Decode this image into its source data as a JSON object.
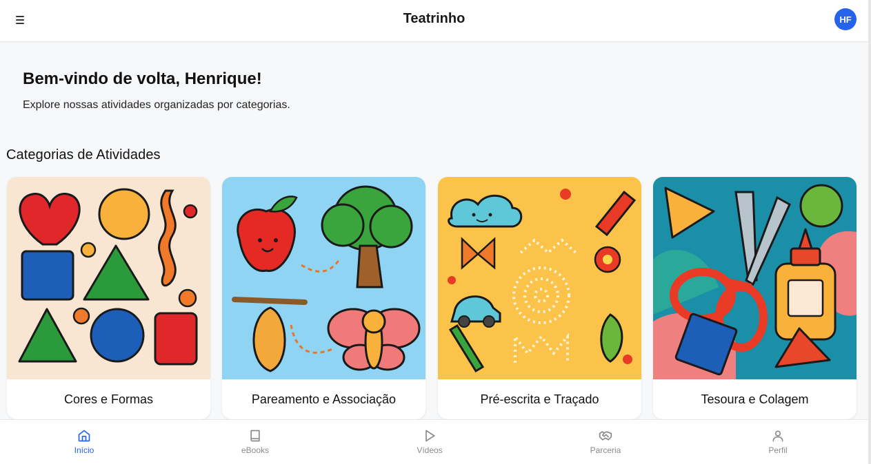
{
  "header": {
    "title": "Teatrinho",
    "avatar_initials": "HF"
  },
  "welcome": {
    "title": "Bem-vindo de volta, Henrique!",
    "subtitle": "Explore nossas atividades organizadas por categorias."
  },
  "categories": {
    "title": "Categorias de Atividades",
    "items": [
      {
        "label": "Cores e Formas",
        "bg": "#f8e6d2"
      },
      {
        "label": "Pareamento e Associação",
        "bg": "#8fd4f2"
      },
      {
        "label": "Pré-escrita e Traçado",
        "bg": "#fbc34a"
      },
      {
        "label": "Tesoura e Colagem",
        "bg": "#1c8fa8"
      }
    ]
  },
  "bottom_nav": {
    "items": [
      {
        "label": "Início",
        "icon": "home-icon",
        "active": true
      },
      {
        "label": "eBooks",
        "icon": "book-icon",
        "active": false
      },
      {
        "label": "Vídeos",
        "icon": "play-icon",
        "active": false
      },
      {
        "label": "Parceria",
        "icon": "handshake-icon",
        "active": false
      },
      {
        "label": "Perfil",
        "icon": "user-icon",
        "active": false
      }
    ]
  },
  "colors": {
    "accent": "#2563eb",
    "inactive": "#8a8a8a",
    "background": "#f7f8fa"
  }
}
